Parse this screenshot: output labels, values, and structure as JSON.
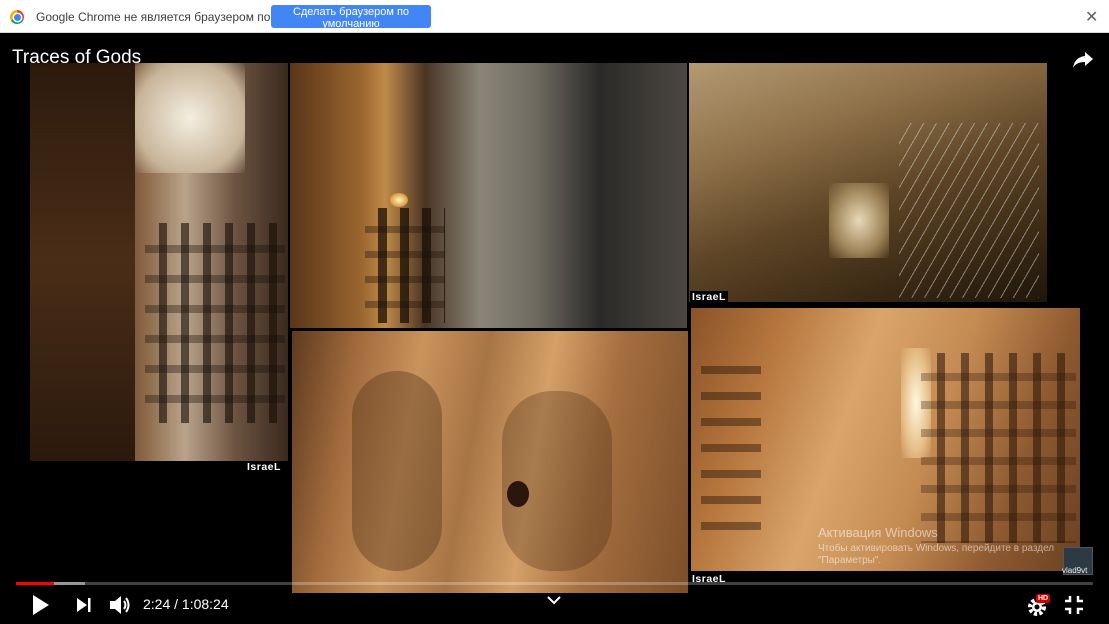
{
  "infobar": {
    "message": "Google Chrome не является браузером по умолчанию.",
    "button_label": "Сделать браузером по умолчанию",
    "close_label": "✕",
    "icon": "chrome-icon"
  },
  "video": {
    "title": "Traces of Gods",
    "share_icon": "share-icon",
    "overlay_labels": [
      "IsraeL",
      "IsraeL",
      "IsraeL"
    ],
    "progress": {
      "played_fraction": 0.0354,
      "buffered_fraction": 0.064
    },
    "time": {
      "current": "2:24",
      "separator": " / ",
      "duration": "1:08:24",
      "display": "2:24 / 1:08:24"
    },
    "quality_badge": "HD",
    "channel_label": "vlad9vt"
  },
  "windows_watermark": {
    "title": "Активация Windows",
    "subtitle": "Чтобы активировать Windows, перейдите в раздел \"Параметры\"."
  },
  "controls": {
    "icons": [
      "play-icon",
      "next-icon",
      "volume-icon",
      "chevron-down-icon",
      "settings-icon",
      "exit-fullscreen-icon"
    ]
  },
  "colors": {
    "progress_played": "#ff0000",
    "infobar_button": "#4285f4",
    "hd_badge": "#cc0000"
  }
}
